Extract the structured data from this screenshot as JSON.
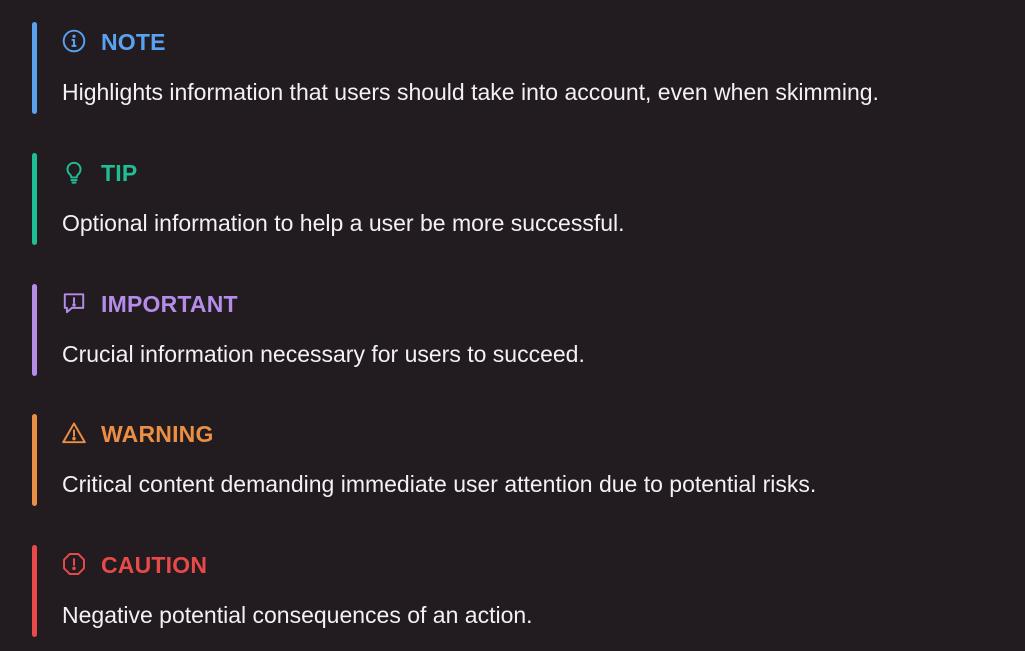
{
  "alerts": [
    {
      "kind": "note",
      "title": "NOTE",
      "text": "Highlights information that users should take into account, even when skimming.",
      "color": "#5aa2f0",
      "icon": "info-circle-icon"
    },
    {
      "kind": "tip",
      "title": "TIP",
      "text": "Optional information to help a user be more successful.",
      "color": "#1fbf95",
      "icon": "lightbulb-icon"
    },
    {
      "kind": "important",
      "title": "IMPORTANT",
      "text": "Crucial information necessary for users to succeed.",
      "color": "#b48de8",
      "icon": "report-message-icon"
    },
    {
      "kind": "warning",
      "title": "WARNING",
      "text": "Critical content demanding immediate user attention due to potential risks.",
      "color": "#ea8f44",
      "icon": "alert-triangle-icon"
    },
    {
      "kind": "caution",
      "title": "CAUTION",
      "text": "Negative potential consequences of an action.",
      "color": "#e84a4a",
      "icon": "stop-octagon-icon"
    }
  ]
}
